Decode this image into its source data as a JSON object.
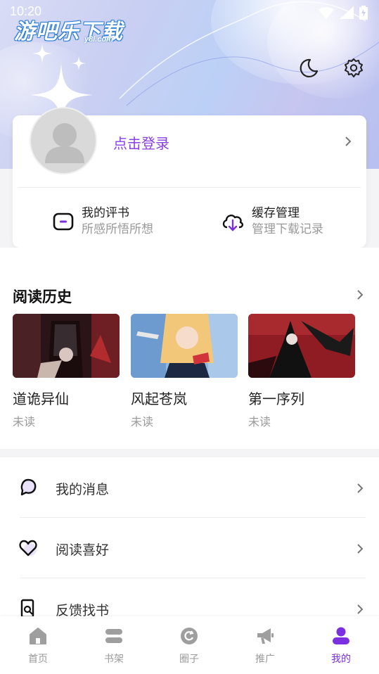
{
  "status_bar": {
    "time": "10:20"
  },
  "header": {
    "logo_text": "游吧乐下载",
    "logo_sub": "y8l.com"
  },
  "login_card": {
    "login_label": "点击登录",
    "quick": [
      {
        "title": "我的评书",
        "subtitle": "所感所悟所想",
        "icon": "comment-square-icon"
      },
      {
        "title": "缓存管理",
        "subtitle": "管理下载记录",
        "icon": "cloud-download-icon"
      }
    ]
  },
  "history": {
    "title": "阅读历史",
    "books": [
      {
        "title": "道诡异仙",
        "status": "未读"
      },
      {
        "title": "风起苍岚",
        "status": "未读"
      },
      {
        "title": "第一序列",
        "status": "未读"
      }
    ]
  },
  "menu": [
    {
      "label": "我的消息",
      "icon": "message-bubble-icon"
    },
    {
      "label": "阅读喜好",
      "icon": "heart-icon"
    },
    {
      "label": "反馈找书",
      "icon": "search-document-icon"
    }
  ],
  "bottom_nav": [
    {
      "label": "首页",
      "icon": "home-icon",
      "active": false
    },
    {
      "label": "书架",
      "icon": "bookshelf-icon",
      "active": false
    },
    {
      "label": "圈子",
      "icon": "circle-icon",
      "active": false
    },
    {
      "label": "推广",
      "icon": "megaphone-icon",
      "active": false
    },
    {
      "label": "我的",
      "icon": "user-icon",
      "active": true
    }
  ],
  "colors": {
    "accent": "#7b2fe0",
    "login": "#8a3fe0"
  }
}
